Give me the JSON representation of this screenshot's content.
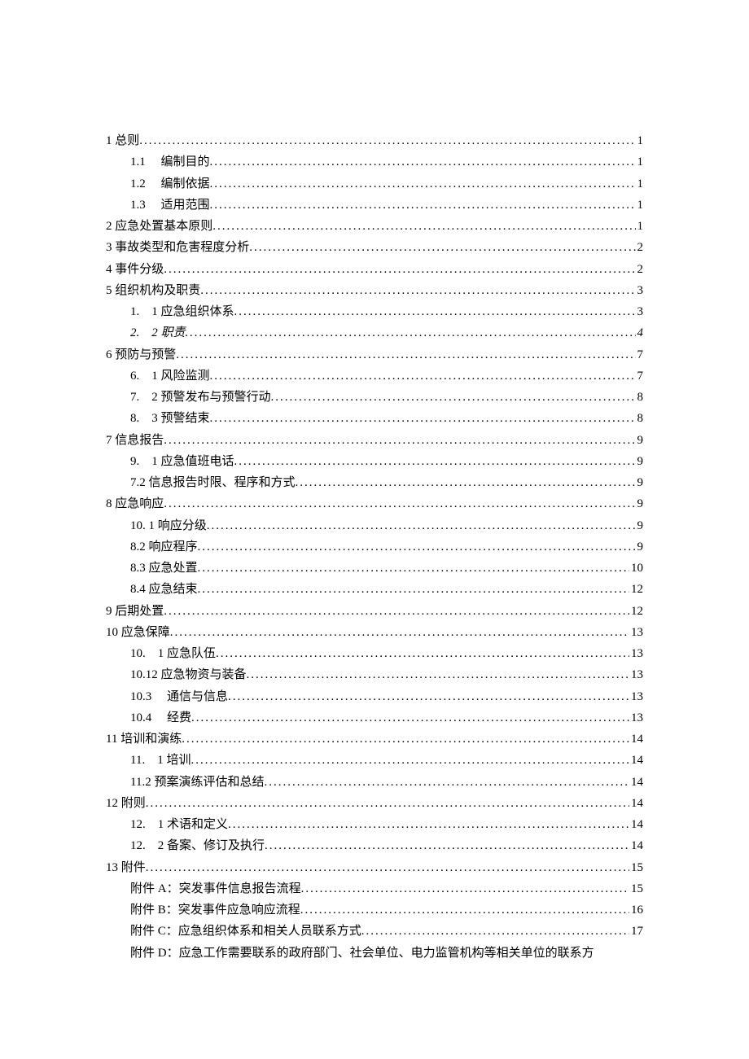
{
  "toc": [
    {
      "level": 1,
      "label": "1 总则",
      "page": "1"
    },
    {
      "level": 2,
      "label": "1.1 　编制目的",
      "page": "1"
    },
    {
      "level": 2,
      "label": "1.2 　编制依据",
      "page": "1"
    },
    {
      "level": 2,
      "label": "1.3 　适用范围",
      "page": "1"
    },
    {
      "level": 1,
      "label": "2 应急处置基本原则",
      "page": "1"
    },
    {
      "level": 1,
      "label": "3 事故类型和危害程度分析",
      "page": "2"
    },
    {
      "level": 1,
      "label": "4 事件分级",
      "page": "2"
    },
    {
      "level": 1,
      "label": "5 组织机构及职责",
      "page": "3"
    },
    {
      "level": 2,
      "label": "1.　1 应急组织体系 ",
      "page": "3"
    },
    {
      "level": 2,
      "label": "2.　2 职责 ",
      "page": "4",
      "italic": true
    },
    {
      "level": 1,
      "label": "6 预防与预警",
      "page": "7"
    },
    {
      "level": 2,
      "label": "6.　1 风险监测 ",
      "page": "7"
    },
    {
      "level": 2,
      "label": "7.　2 预警发布与预警行动 ",
      "page": "8"
    },
    {
      "level": 2,
      "label": "8.　3 预警结束 ",
      "page": "8"
    },
    {
      "level": 1,
      "label": "7 信息报告",
      "page": "9"
    },
    {
      "level": 2,
      "label": "9.　1 应急值班电话 ",
      "page": "9"
    },
    {
      "level": 2,
      "label": "7.2 信息报告时限、程序和方式 ",
      "page": "9"
    },
    {
      "level": 1,
      "label": "8 应急响应",
      "page": "9"
    },
    {
      "level": 2,
      "label": "10. 1 响应分级 ",
      "page": "9"
    },
    {
      "level": 2,
      "label": "8.2 响应程序 ",
      "page": "9"
    },
    {
      "level": 2,
      "label": "8.3 应急处置 ",
      "page": "10"
    },
    {
      "level": 2,
      "label": "8.4 应急结束 ",
      "page": "12"
    },
    {
      "level": 1,
      "label": "9 后期处置",
      "page": "12"
    },
    {
      "level": 1,
      "label": "10 应急保障",
      "page": "13"
    },
    {
      "level": 2,
      "label": "10.　1 应急队伍 ",
      "page": "13"
    },
    {
      "level": 2,
      "label": "10.12 应急物资与装备 ",
      "page": "13"
    },
    {
      "level": 2,
      "label": "10.3 　通信与信息 ",
      "page": "13"
    },
    {
      "level": 2,
      "label": "10.4 　经费 ",
      "page": "13"
    },
    {
      "level": 1,
      "label": "11 培训和演练",
      "page": "14"
    },
    {
      "level": 2,
      "label": "11.　1 培训 ",
      "page": "14"
    },
    {
      "level": 2,
      "label": "11.2 预案演练评估和总结 ",
      "page": "14"
    },
    {
      "level": 1,
      "label": "12 附则",
      "page": "14"
    },
    {
      "level": 2,
      "label": "12.　1 术语和定义 ",
      "page": "14"
    },
    {
      "level": 2,
      "label": "12.　2 备案、修订及执行 ",
      "page": "14"
    },
    {
      "level": 1,
      "label": "13 附件",
      "page": "15"
    },
    {
      "level": 2,
      "label": "附件 A：突发事件信息报告流程 ",
      "page": "15"
    },
    {
      "level": 2,
      "label": "附件 B：突发事件应急响应流程 ",
      "page": "16"
    },
    {
      "level": 2,
      "label": "附件 C：应急组织体系和相关人员联系方式 ",
      "page": "17"
    }
  ],
  "last_line": "附件 D：应急工作需要联系的政府部门、社会单位、电力监管机构等相关单位的联系方"
}
